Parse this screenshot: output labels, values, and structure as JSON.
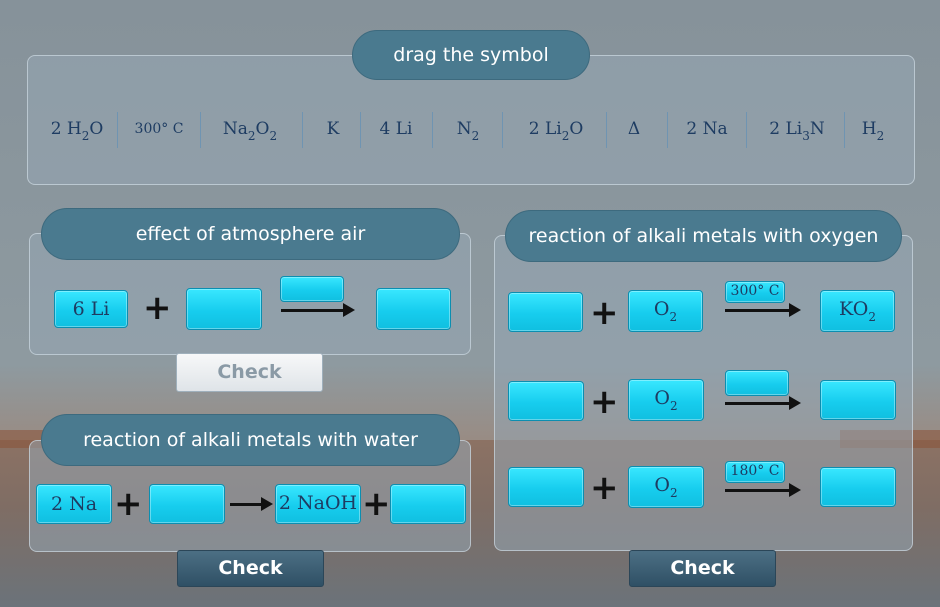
{
  "title": "drag the symbol",
  "symbols": [
    {
      "text": "2 H",
      "sub": "2",
      "after": "O"
    },
    {
      "text": "300° C",
      "sub": "",
      "after": ""
    },
    {
      "text": "Na",
      "sub": "2",
      "after": "O",
      "sub2": "2"
    },
    {
      "text": "K",
      "sub": "",
      "after": ""
    },
    {
      "text": "4 Li",
      "sub": "",
      "after": ""
    },
    {
      "text": "N",
      "sub": "2",
      "after": ""
    },
    {
      "text": "2 Li",
      "sub": "2",
      "after": "O"
    },
    {
      "text": "Δ",
      "sub": "",
      "after": ""
    },
    {
      "text": "2 Na",
      "sub": "",
      "after": ""
    },
    {
      "text": "2 Li",
      "sub": "3",
      "after": "N"
    },
    {
      "text": "H",
      "sub": "2",
      "after": ""
    }
  ],
  "atmosphere": {
    "title": "effect of atmosphere air",
    "reactant1": "6 Li",
    "reactant2": "",
    "condition": "",
    "product": "",
    "check_label": "Check"
  },
  "oxygen": {
    "title": "reaction of alkali metals with oxygen",
    "rows": [
      {
        "metal": "",
        "oxidant": "O",
        "oxidant_sub": "2",
        "condition": "300° C",
        "product": "KO",
        "product_sub": "2"
      },
      {
        "metal": "",
        "oxidant": "O",
        "oxidant_sub": "2",
        "condition": "",
        "product": "",
        "product_sub": ""
      },
      {
        "metal": "",
        "oxidant": "O",
        "oxidant_sub": "2",
        "condition": "180° C",
        "product": "",
        "product_sub": ""
      }
    ],
    "check_label": "Check"
  },
  "water": {
    "title": "reaction of alkali metals with water",
    "reactant1": "2 Na",
    "reactant2": "",
    "product1": "2 NaOH",
    "product2": "",
    "check_label": "Check"
  },
  "colors": {
    "slot": "#17cdee",
    "pill": "#4a7a8f",
    "text": "#1e3c62"
  }
}
